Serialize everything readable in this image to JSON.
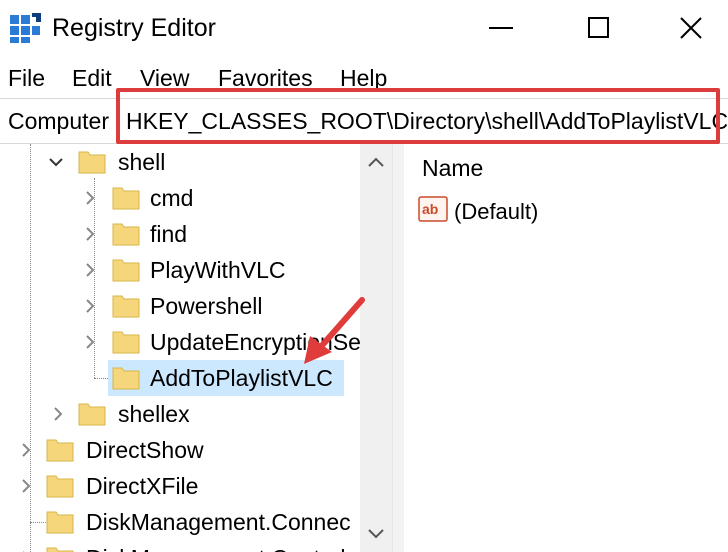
{
  "window": {
    "title": "Registry Editor",
    "controls": {
      "minimize": "minimize-icon",
      "maximize": "maximize-icon",
      "close": "close-icon"
    }
  },
  "menu": {
    "items": [
      {
        "label": "File"
      },
      {
        "label": "Edit"
      },
      {
        "label": "View"
      },
      {
        "label": "Favorites"
      },
      {
        "label": "Help"
      }
    ]
  },
  "address": {
    "root": "Computer",
    "path": "HKEY_CLASSES_ROOT\\Directory\\shell\\AddToPlaylistVLC",
    "highlight_color": "#dc3c3c"
  },
  "tree": {
    "nodes": [
      {
        "label": "shell",
        "expanded": true
      },
      {
        "label": "cmd"
      },
      {
        "label": "find"
      },
      {
        "label": "PlayWithVLC"
      },
      {
        "label": "Powershell"
      },
      {
        "label": "UpdateEncryptionSe"
      },
      {
        "label": "AddToPlaylistVLC",
        "selected": true
      },
      {
        "label": "shellex"
      },
      {
        "label": "DirectShow"
      },
      {
        "label": "DirectXFile"
      },
      {
        "label": "DiskManagement.Connec"
      },
      {
        "label": "DiskManagement.Control"
      }
    ],
    "selected_color": "#cce8ff",
    "folder_color": "#f5d67a"
  },
  "values_pane": {
    "column_name": "Name",
    "rows": [
      {
        "name": "(Default)",
        "icon": "ab-string-icon"
      }
    ]
  },
  "annotation": {
    "arrow_color": "#e03c3c"
  }
}
